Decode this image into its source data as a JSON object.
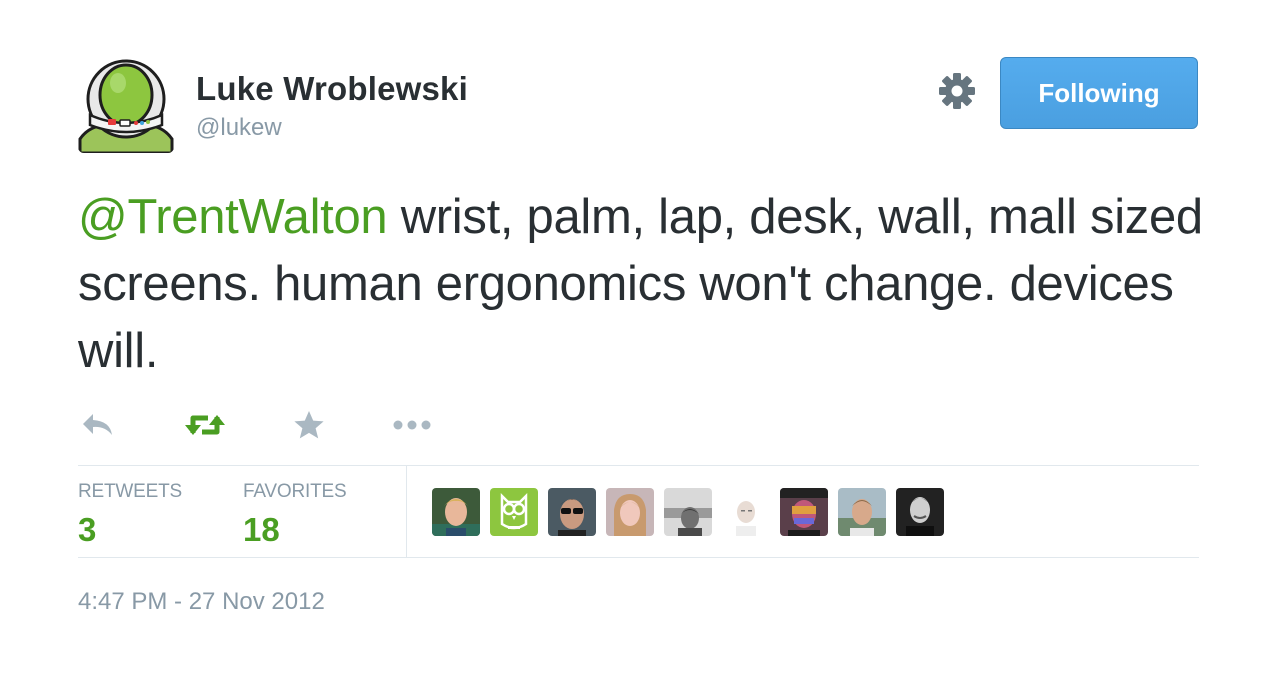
{
  "author": {
    "name": "Luke Wroblewski",
    "handle": "@lukew",
    "avatar_icon": "astronaut-helmet-avatar"
  },
  "header": {
    "settings_icon": "gear-icon",
    "follow_button_label": "Following"
  },
  "tweet": {
    "mention": "@TrentWalton",
    "text": " wrist, palm, lap, desk, wall, mall sized screens. human ergonomics won't change. devices will."
  },
  "actions": [
    {
      "name": "reply",
      "icon": "reply-icon"
    },
    {
      "name": "retweet",
      "icon": "retweet-icon",
      "active": true
    },
    {
      "name": "favorite",
      "icon": "star-icon"
    },
    {
      "name": "more",
      "icon": "more-dots-icon"
    }
  ],
  "stats": {
    "retweets_label": "RETWEETS",
    "retweets_count": "3",
    "favorites_label": "FAVORITES",
    "favorites_count": "18"
  },
  "engaged_users": [
    {
      "icon": "user-avatar-blond-man"
    },
    {
      "icon": "user-avatar-owl-logo"
    },
    {
      "icon": "user-avatar-sunglasses-man"
    },
    {
      "icon": "user-avatar-woman"
    },
    {
      "icon": "user-avatar-grayscale-man"
    },
    {
      "icon": "user-avatar-bald-man"
    },
    {
      "icon": "user-avatar-colorful-man"
    },
    {
      "icon": "user-avatar-outdoor-man"
    },
    {
      "icon": "user-avatar-dark-man"
    }
  ],
  "timestamp": "4:47 PM - 27 Nov 2012",
  "colors": {
    "accent_green": "#4a9e22",
    "button_blue": "#55acee",
    "muted_gray": "#8899a6",
    "text_dark": "#292f33",
    "divider": "#e1e8ed"
  }
}
